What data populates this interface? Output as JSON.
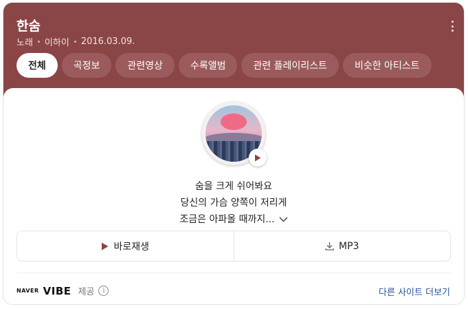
{
  "header": {
    "title": "한숨",
    "meta": [
      "노래",
      "이하이",
      "2016.03.09."
    ],
    "more_icon": "vertical-ellipsis-icon",
    "colors": {
      "background": "#8a4546",
      "tab": "#9b5b5c"
    }
  },
  "tabs": [
    {
      "label": "전체",
      "active": true
    },
    {
      "label": "곡정보",
      "active": false
    },
    {
      "label": "관련영상",
      "active": false
    },
    {
      "label": "수록앨범",
      "active": false
    },
    {
      "label": "관련 플레이리스트",
      "active": false
    },
    {
      "label": "비슷한 아티스트",
      "active": false
    }
  ],
  "album": {
    "play_icon": "play-icon"
  },
  "lyrics": {
    "lines": [
      "숨을 크게 쉬어봐요",
      "당신의 가슴 양쪽이 저리게",
      "조금은 아파올 때까지..."
    ],
    "expand_icon": "chevron-down-icon"
  },
  "actions": {
    "play": {
      "label": "바로재생",
      "icon": "play-icon"
    },
    "mp3": {
      "label": "MP3",
      "icon": "download-icon"
    }
  },
  "footer": {
    "naver": "NAVER",
    "vibe": "VIBE",
    "provided": "제공",
    "info_icon": "info-icon",
    "more_sites": "다른 사이트 더보기"
  }
}
